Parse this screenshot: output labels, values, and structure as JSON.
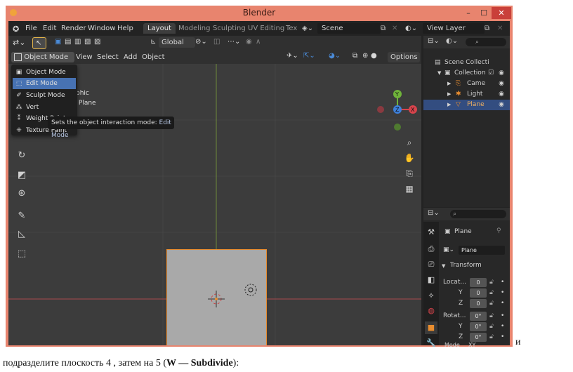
{
  "window": {
    "title": "Blender",
    "min": "–",
    "max": "☐",
    "close": "✕"
  },
  "menubar": {
    "items": [
      "File",
      "Edit",
      "Render",
      "Window",
      "Help"
    ],
    "workspaces": [
      "Layout",
      "Modeling",
      "Sculpting",
      "UV Editing",
      "Tex"
    ],
    "scene": "Scene",
    "view_layer": "View Layer"
  },
  "viewport_header": {
    "mode": "Object Mode",
    "menus": [
      "View",
      "Select",
      "Add",
      "Object"
    ],
    "orientation": "Global",
    "options": "Options"
  },
  "overlay_text": {
    "line1": "phic",
    "line2": "| Plane"
  },
  "mode_menu": {
    "items": [
      "Object Mode",
      "Edit Mode",
      "Sculpt Mode",
      "Vertex Paint",
      "Weight Paint",
      "Texture Paint"
    ],
    "visible_labels": [
      "Object Mode",
      "Edit Mode",
      "Sculpt Mode",
      "Vert",
      "Weight Paint",
      "Texture Paint"
    ],
    "selected_index": 1
  },
  "tooltip": {
    "text": "Sets the object interaction mode:",
    "value": "Edit Mode"
  },
  "outliner": {
    "title": "Scene Collecti",
    "rows": [
      {
        "label": "Collection"
      },
      {
        "label": "Came"
      },
      {
        "label": "Light"
      },
      {
        "label": "Plane"
      }
    ]
  },
  "properties": {
    "object_name": "Plane",
    "data_name": "Plane",
    "section": "Transform",
    "location_label": "Locat...",
    "rotation_label": "Rotat...",
    "mode_label": "Mode",
    "mode_value": "XY",
    "axes": [
      "Y",
      "Z"
    ],
    "location": [
      "0",
      "0",
      "0"
    ],
    "rotation": [
      "0°",
      "0°",
      "0°"
    ]
  },
  "trailing_char": "и",
  "caption": {
    "prefix": "подразделите плоскость 4 , затем на 5 (",
    "bold": "W — Subdivide",
    "suffix": "):"
  },
  "colors": {
    "titlebar": "#e8846e",
    "selection": "#4772b3",
    "plane_outline": "#e98d2f",
    "axis_x": "#d8444c",
    "axis_y": "#6fb33a",
    "axis_z": "#3d7fd9"
  }
}
